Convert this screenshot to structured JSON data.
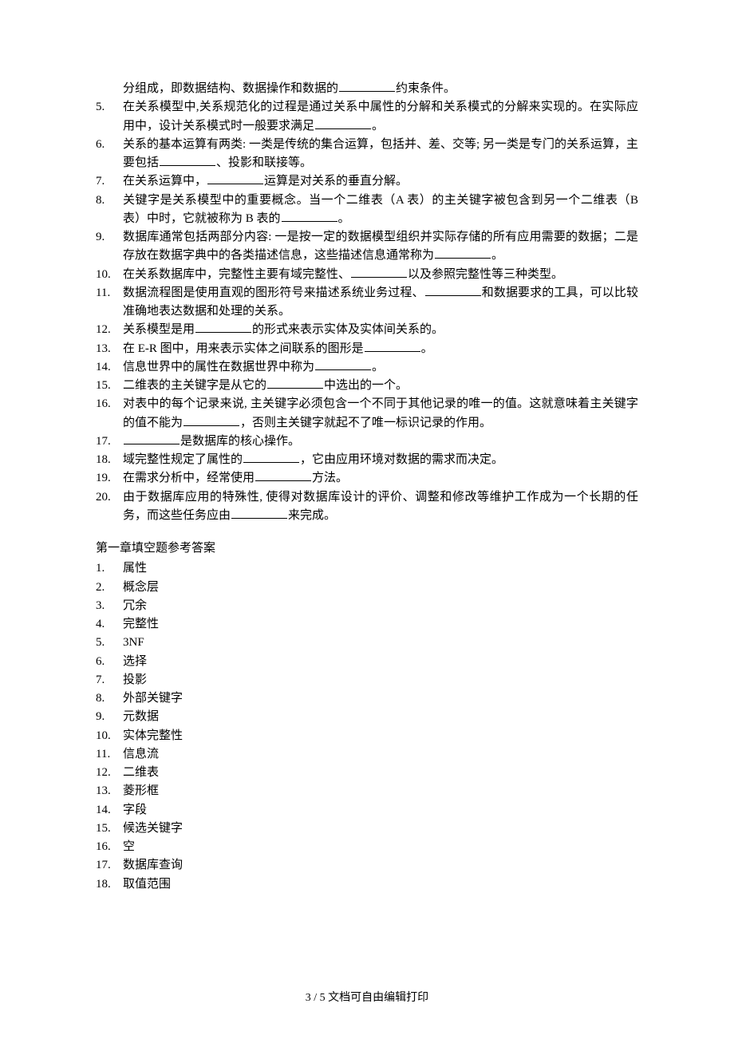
{
  "questions": [
    {
      "num": "",
      "parts": [
        "分组成，即数据结构、数据操作和数据的",
        "BLANK",
        "约束条件。"
      ],
      "continuation": true
    },
    {
      "num": "5.",
      "parts": [
        "在关系模型中,关系规范化的过程是通过关系中属性的分解和关系模式的分解来实现的。在实际应用中，设计关系模式时一般要求满足",
        "BLANK",
        "。"
      ]
    },
    {
      "num": "6.",
      "parts": [
        "关系的基本运算有两类: 一类是传统的集合运算，包括并、差、交等; 另一类是专门的关系运算，主要包括",
        "BLANK",
        "、投影和联接等。"
      ]
    },
    {
      "num": "7.",
      "parts": [
        "在关系运算中，",
        "BLANK",
        "运算是对关系的垂直分解。"
      ]
    },
    {
      "num": "8.",
      "parts": [
        "关键字是关系模型中的重要概念。当一个二维表（A 表）的主关键字被包含到另一个二维表（B 表）中时，它就被称为 B 表的",
        "BLANK",
        "。"
      ]
    },
    {
      "num": "9.",
      "parts": [
        "数据库通常包括两部分内容: 一是按一定的数据模型组织并实际存储的所有应用需要的数据；二是存放在数据字典中的各类描述信息，这些描述信息通常称为",
        "BLANK",
        "。"
      ]
    },
    {
      "num": "10.",
      "parts": [
        "在关系数据库中，完整性主要有域完整性、",
        "BLANK",
        "以及参照完整性等三种类型。"
      ]
    },
    {
      "num": "11.",
      "parts": [
        "数据流程图是使用直观的图形符号来描述系统业务过程、",
        "BLANK",
        "和数据要求的工具，可以比较准确地表达数据和处理的关系。"
      ]
    },
    {
      "num": "12.",
      "parts": [
        "关系模型是用",
        "BLANK",
        "的形式来表示实体及实体间关系的。"
      ]
    },
    {
      "num": "13.",
      "parts": [
        "在 E-R 图中，用来表示实体之间联系的图形是",
        "BLANK",
        "。"
      ]
    },
    {
      "num": "14.",
      "parts": [
        "信息世界中的属性在数据世界中称为",
        "BLANK",
        "。"
      ]
    },
    {
      "num": "15.",
      "parts": [
        "二维表的主关键字是从它的",
        "BLANK",
        "中选出的一个。"
      ]
    },
    {
      "num": "16.",
      "parts": [
        "对表中的每个记录来说, 主关键字必须包含一个不同于其他记录的唯一的值。这就意味着主关键字的值不能为",
        "BLANK",
        "，否则主关键字就起不了唯一标识记录的作用。"
      ]
    },
    {
      "num": "17.",
      "parts": [
        "",
        "BLANK",
        "是数据库的核心操作。"
      ]
    },
    {
      "num": "18.",
      "parts": [
        "域完整性规定了属性的",
        "BLANK",
        "，它由应用环境对数据的需求而决定。"
      ]
    },
    {
      "num": "19.",
      "parts": [
        "在需求分析中，经常使用",
        "BLANK",
        "方法。"
      ]
    },
    {
      "num": "20.",
      "parts": [
        "由于数据库应用的特殊性, 使得对数据库设计的评价、调整和修改等维护工作成为一个长期的任务，而这些任务应由",
        "BLANK",
        "来完成。"
      ]
    }
  ],
  "answers_heading": "第一章填空题参考答案",
  "answers": [
    {
      "num": "1.",
      "text": "属性"
    },
    {
      "num": "2.",
      "text": "概念层"
    },
    {
      "num": "3.",
      "text": "冗余"
    },
    {
      "num": "4.",
      "text": "完整性"
    },
    {
      "num": "5.",
      "text": "3NF"
    },
    {
      "num": "6.",
      "text": "选择"
    },
    {
      "num": "7.",
      "text": "投影"
    },
    {
      "num": "8.",
      "text": "外部关键字"
    },
    {
      "num": "9.",
      "text": "元数据"
    },
    {
      "num": "10.",
      "text": "实体完整性"
    },
    {
      "num": "11.",
      "text": "信息流"
    },
    {
      "num": "12.",
      "text": "二维表"
    },
    {
      "num": "13.",
      "text": "菱形框"
    },
    {
      "num": "14.",
      "text": "字段"
    },
    {
      "num": "15.",
      "text": "候选关键字"
    },
    {
      "num": "16.",
      "text": "空"
    },
    {
      "num": "17.",
      "text": "数据库查询"
    },
    {
      "num": "18.",
      "text": "取值范围"
    }
  ],
  "footer": "3 / 5 文档可自由编辑打印"
}
